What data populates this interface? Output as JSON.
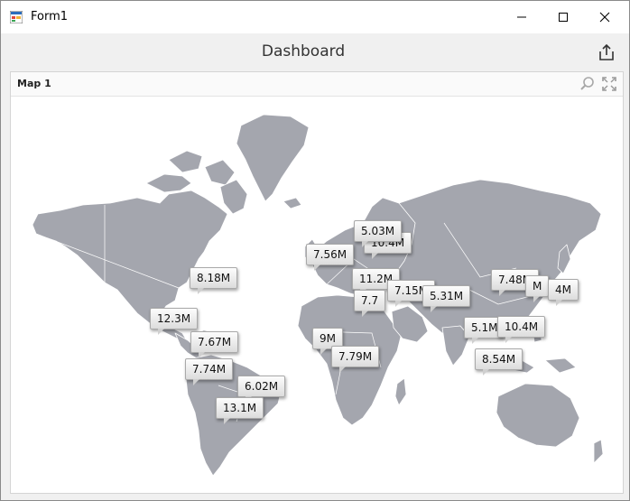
{
  "window": {
    "title": "Form1",
    "icons": {
      "app": "winforms-app-icon",
      "minimize": "minimize-icon",
      "maximize": "maximize-icon",
      "close": "close-icon"
    }
  },
  "dashboard": {
    "title": "Dashboard",
    "export_icon": "export-icon"
  },
  "map_item": {
    "title": "Map 1",
    "icons": {
      "zoom": "zoom-icon",
      "fullscreen": "fullscreen-icon"
    },
    "land_color": "#a4a6ae",
    "callouts": [
      {
        "label": "8.18M"
      },
      {
        "label": "12.3M"
      },
      {
        "label": "7.67M"
      },
      {
        "label": "7.74M"
      },
      {
        "label": "6.02M"
      },
      {
        "label": "13.1M"
      },
      {
        "label": "7.56M"
      },
      {
        "label": "10.4M"
      },
      {
        "label": "5.03M"
      },
      {
        "label": "11.2M"
      },
      {
        "label": "7.7"
      },
      {
        "label": "7.15M"
      },
      {
        "label": "9M"
      },
      {
        "label": "7.79M"
      },
      {
        "label": "5.31M"
      },
      {
        "label": "5.1M"
      },
      {
        "label": "10.4M"
      },
      {
        "label": "7.48M"
      },
      {
        "label": "M"
      },
      {
        "label": "4M"
      },
      {
        "label": "8.54M"
      }
    ]
  }
}
